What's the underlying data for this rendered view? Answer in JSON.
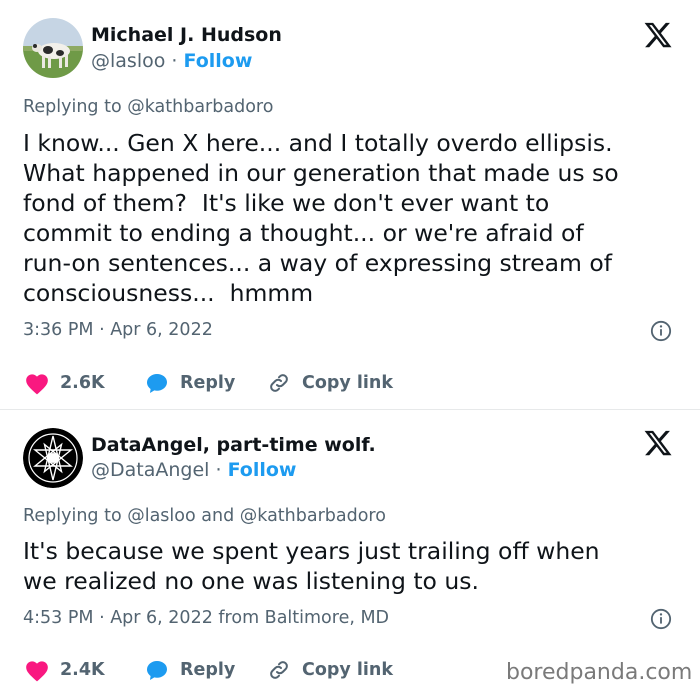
{
  "tweets": [
    {
      "author_name": "Michael J. Hudson",
      "handle": "@lasloo",
      "separator": "·",
      "follow_label": "Follow",
      "replying_to": "Replying to @kathbarbadoro",
      "text": "I know... Gen X here... and I totally overdo ellipsis.\nWhat happened in our generation that made us so\nfond of them?  It's like we don't ever want to\ncommit to ending a thought... or we're afraid of\nrun-on sentences... a way of expressing stream of\nconsciousness...  hmmm",
      "timestamp": "3:36 PM · Apr 6, 2022",
      "likes": "2.6K",
      "reply_label": "Reply",
      "copy_link_label": "Copy link"
    },
    {
      "author_name": "DataAngel, part-time wolf.",
      "handle": "@DataAngel",
      "separator": "·",
      "follow_label": "Follow",
      "replying_to": "Replying to @lasloo and @kathbarbadoro",
      "text": "It's because we spent years just trailing off when\nwe realized no one was listening to us.",
      "timestamp": "4:53 PM · Apr 6, 2022 from Baltimore, MD",
      "likes": "2.4K",
      "reply_label": "Reply",
      "copy_link_label": "Copy link"
    }
  ],
  "watermark": "boredpanda.com",
  "icons": {
    "brand": "x-logo-icon",
    "like": "heart-icon",
    "reply": "reply-bubble-icon",
    "copy": "link-icon",
    "info": "info-icon"
  },
  "colors": {
    "text": "#0f1419",
    "secondary": "#536471",
    "accent": "#1d9bf0",
    "like": "#f91880",
    "divider": "#e7e9ea"
  }
}
